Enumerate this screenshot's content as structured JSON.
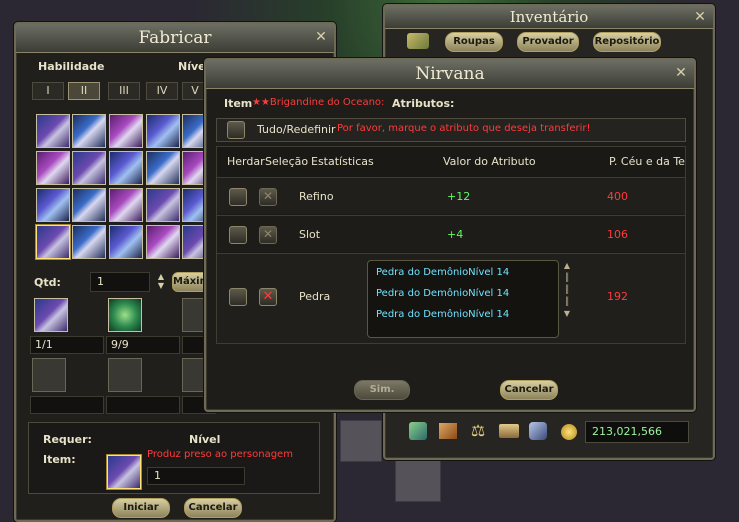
{
  "fabricar": {
    "title": "Fabricar",
    "habilidade_label": "Habilidade",
    "nivel_label": "Nível",
    "tabs": [
      "I",
      "II",
      "III",
      "IV",
      "V"
    ],
    "qtd_label": "Qtd:",
    "qtd_value": "1",
    "max_button": "Máximo",
    "material_counts": [
      "1/1",
      "9/9"
    ],
    "requer_label": "Requer:",
    "nivel_req_label": "Nível",
    "item_label": "Item:",
    "bind_note": "Produz preso ao personagem",
    "item_qty": "1",
    "start_button": "Iniciar",
    "cancel_button": "Cancelar"
  },
  "inventario": {
    "title": "Inventário",
    "tabs": [
      "Roupas",
      "Provador",
      "Repositório"
    ],
    "gold": "213,021,566"
  },
  "nirvana": {
    "title": "Nirvana",
    "item_label": "Item",
    "item_name": "★★Brigandine do Oceano:",
    "attributes_label": "Atributos:",
    "select_all_label": "Tudo/Redefinir",
    "instruction": "Por favor, marque o atributo que deseja transferir!",
    "columns": [
      "Herdar",
      "Seleção",
      "Estatísticas",
      "Valor do Atributo",
      "P. Céu e da Terra"
    ],
    "rows": [
      {
        "stat": "Refino",
        "value": "+12",
        "cost": "400"
      },
      {
        "stat": "Slot",
        "value": "+4",
        "cost": "106"
      },
      {
        "stat": "Pedra",
        "value": "",
        "cost": "192"
      }
    ],
    "stones": [
      "Pedra do DemônioNível 14",
      "Pedra do DemônioNível 14",
      "Pedra do DemônioNível 14"
    ],
    "confirm_button": "Sim.",
    "cancel_button": "Cancelar"
  },
  "colors": {
    "value_green": "#5dff5d",
    "cost_red": "#ff3b3b",
    "item_red": "#ff3b3b",
    "stone_cyan": "#6fe2ff",
    "title_gold": "#f0ead2"
  }
}
